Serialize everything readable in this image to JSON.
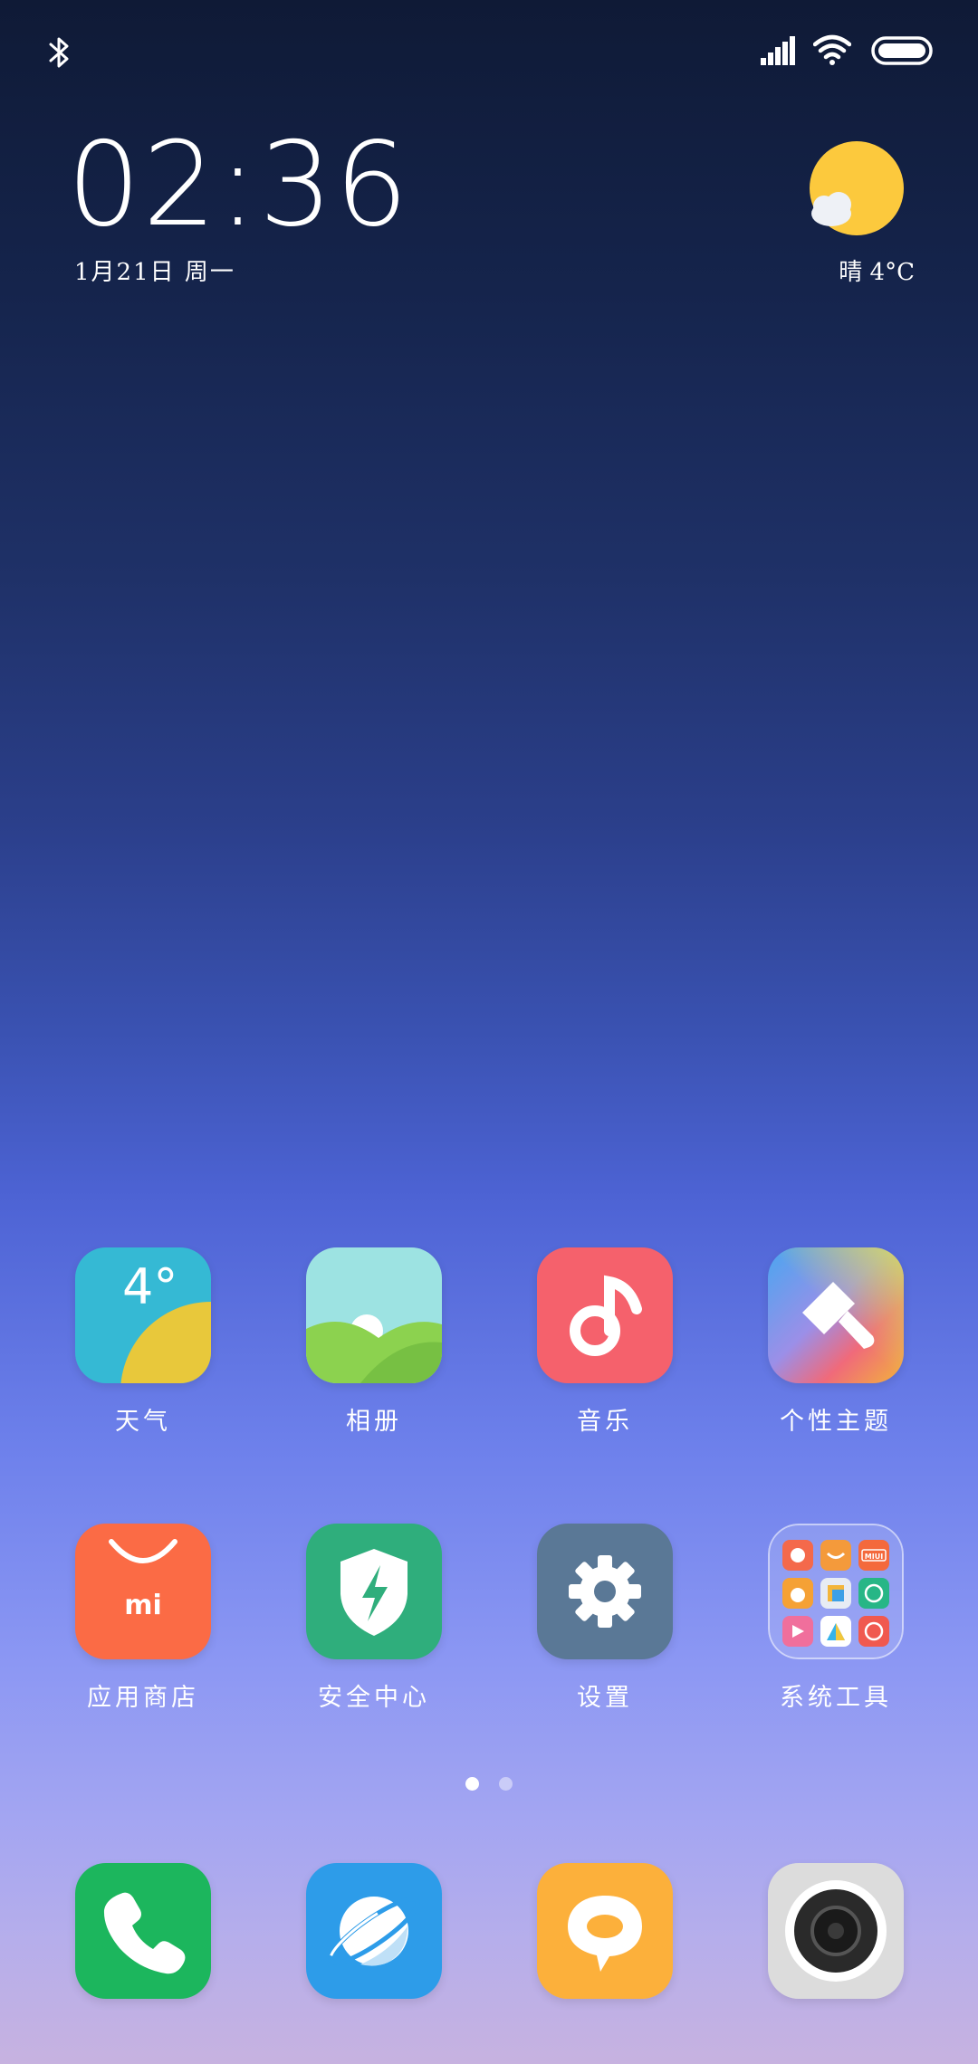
{
  "status_bar": {
    "left_icons": [
      "bluetooth-icon"
    ],
    "right_icons": [
      "cellular-signal-icon",
      "wifi-icon",
      "battery-icon"
    ]
  },
  "clock_widget": {
    "time": "02:36",
    "date": "1月21日 周一",
    "weather_icon": "sun-cloud-icon",
    "weather": "晴  4°C"
  },
  "apps": [
    {
      "label": "天气",
      "icon": "weather-icon",
      "icon_text": "4°",
      "color": "#35b9d4"
    },
    {
      "label": "相册",
      "icon": "gallery-icon",
      "color": "#9de3e2"
    },
    {
      "label": "音乐",
      "icon": "music-icon",
      "color": "#f5616c"
    },
    {
      "label": "个性主题",
      "icon": "theme-brush-icon",
      "color": "#f2a73e"
    },
    {
      "label": "应用商店",
      "icon": "app-store-bag-icon",
      "icon_text": "mi",
      "color": "#fb6b45"
    },
    {
      "label": "安全中心",
      "icon": "security-shield-icon",
      "color": "#2fae7c"
    },
    {
      "label": "设置",
      "icon": "settings-gear-icon",
      "color": "#5a7896"
    },
    {
      "label": "系统工具",
      "icon": "folder-icon",
      "folder_tiles": [
        "MIUI"
      ],
      "color": "#7c88e4"
    }
  ],
  "page_indicator": {
    "pages": 2,
    "current": 1
  },
  "dock": [
    {
      "icon": "phone-icon",
      "color": "#1cb65d"
    },
    {
      "icon": "browser-planet-icon",
      "color": "#2d9ce9"
    },
    {
      "icon": "messages-bubble-icon",
      "color": "#fcb03b"
    },
    {
      "icon": "camera-icon",
      "color": "#dcdcdc"
    }
  ]
}
